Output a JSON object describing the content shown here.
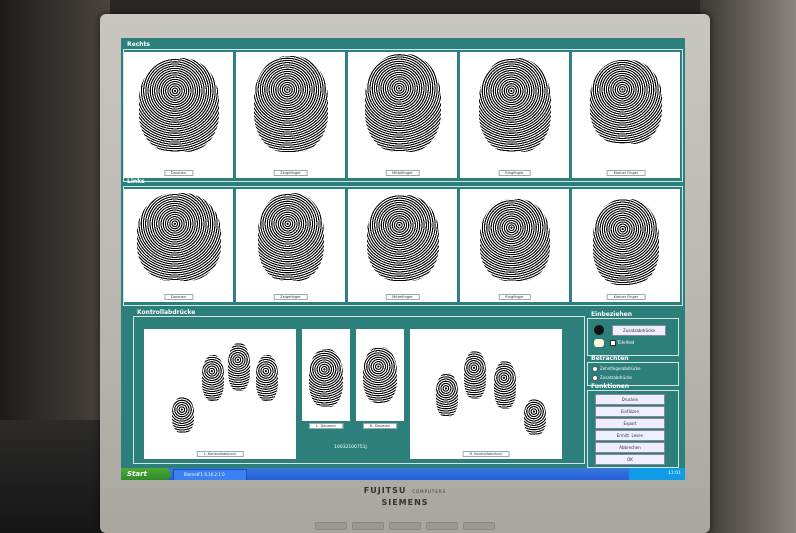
{
  "screen": {
    "rechts": {
      "title": "Rechts",
      "fingers": [
        "Daumen",
        "Zeigefinger",
        "Mittelfinger",
        "Ringfinger",
        "Kleiner Finger"
      ]
    },
    "links": {
      "title": "Links",
      "fingers": [
        "Daumen",
        "Zeigefinger",
        "Mittelfinger",
        "Ringfinger",
        "Kleiner Finger"
      ]
    },
    "kontroll": {
      "title": "Kontrollabdrücke",
      "left_caption": "L. Kontrollabdruck",
      "left_thumb": "L. Daumen",
      "right_thumb": "R. Daumen",
      "right_caption": "R. Kontrollabdruck",
      "id_number": "10032100751J"
    },
    "einbeziehen": {
      "title": "Einbeziehen",
      "button": "Zusatzabdrücke",
      "checkbox": "Tüfelfeld"
    },
    "betrachten": {
      "title": "Betrachten",
      "options": [
        "Zehnfingerabdrücke",
        "Zusatzabdrücke"
      ]
    },
    "funktionen": {
      "title": "Funktionen",
      "buttons": [
        "Drucken",
        "Einfälzen",
        "Export",
        "Ermitt. Lesen",
        "Abbrechen",
        "OK"
      ]
    },
    "taskbar": {
      "start": "Start",
      "task": "BiometF1 6.10.2.1 0",
      "clock": "11:01"
    }
  },
  "monitor": {
    "brand_top": "FUJITSU",
    "brand_small": "COMPUTERS",
    "brand_bottom": "SIEMENS"
  }
}
